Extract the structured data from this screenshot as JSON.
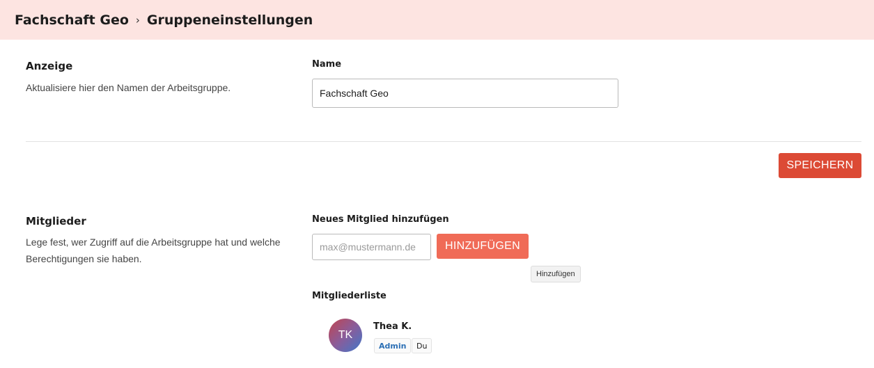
{
  "breadcrumb": {
    "group": "Fachschaft Geo",
    "separator": "›",
    "page": "Gruppeneinstellungen"
  },
  "display_section": {
    "title": "Anzeige",
    "description": "Aktualisiere hier den Namen der Arbeitsgruppe.",
    "name_label": "Name",
    "name_value": "Fachschaft Geo",
    "save_button": "SPEICHERN"
  },
  "members_section": {
    "title": "Mitglieder",
    "description_line1": "Lege fest, wer Zugriff auf die Arbeitsgruppe hat und welche",
    "description_line2": "Berechtigungen sie haben.",
    "add_label": "Neues Mitglied hinzufügen",
    "email_placeholder": "max@mustermann.de",
    "add_button": "HINZUFÜGEN",
    "add_tooltip": "Hinzufügen",
    "list_label": "Mitgliederliste",
    "members": [
      {
        "initials": "TK",
        "name": "Thea K.",
        "role_badge": "Admin",
        "self_badge": "Du"
      }
    ]
  },
  "colors": {
    "header_bg": "#fde4e1",
    "save_button": "#dc4a35",
    "add_button": "#f06b57",
    "admin_badge_text": "#2b6fb5"
  }
}
